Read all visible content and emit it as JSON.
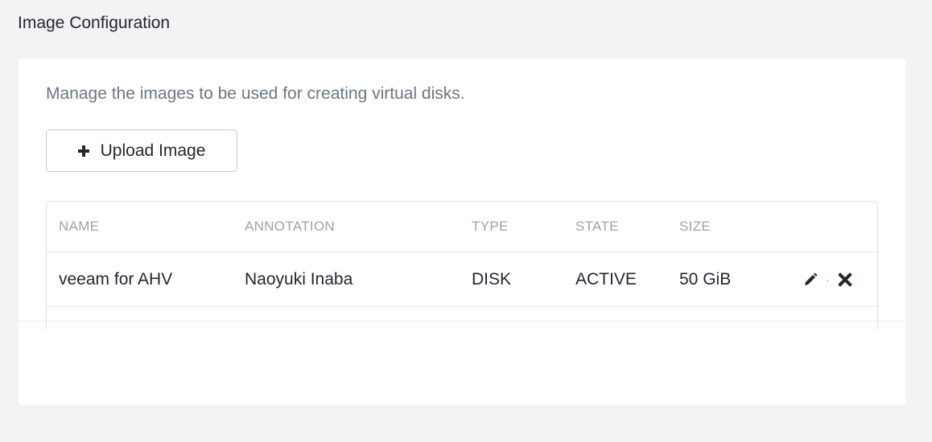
{
  "page": {
    "title": "Image Configuration"
  },
  "card": {
    "description": "Manage the images to be used for creating virtual disks.",
    "upload_label": "Upload Image"
  },
  "table": {
    "columns": [
      "NAME",
      "ANNOTATION",
      "TYPE",
      "STATE",
      "SIZE"
    ],
    "rows": [
      {
        "name": "veeam for AHV",
        "annotation": "Naoyuki Inaba",
        "type": "DISK",
        "state": "ACTIVE",
        "size": "50 GiB"
      }
    ],
    "action_separator": "·"
  },
  "icons": {
    "upload": "plus-icon",
    "edit": "pencil-icon",
    "delete": "close-icon"
  },
  "colors": {
    "background": "#f2f3f5",
    "card": "#ffffff",
    "text": "#22272e",
    "muted": "#6b7684",
    "header_text": "#9aa3ae",
    "border": "#dde1e6"
  }
}
